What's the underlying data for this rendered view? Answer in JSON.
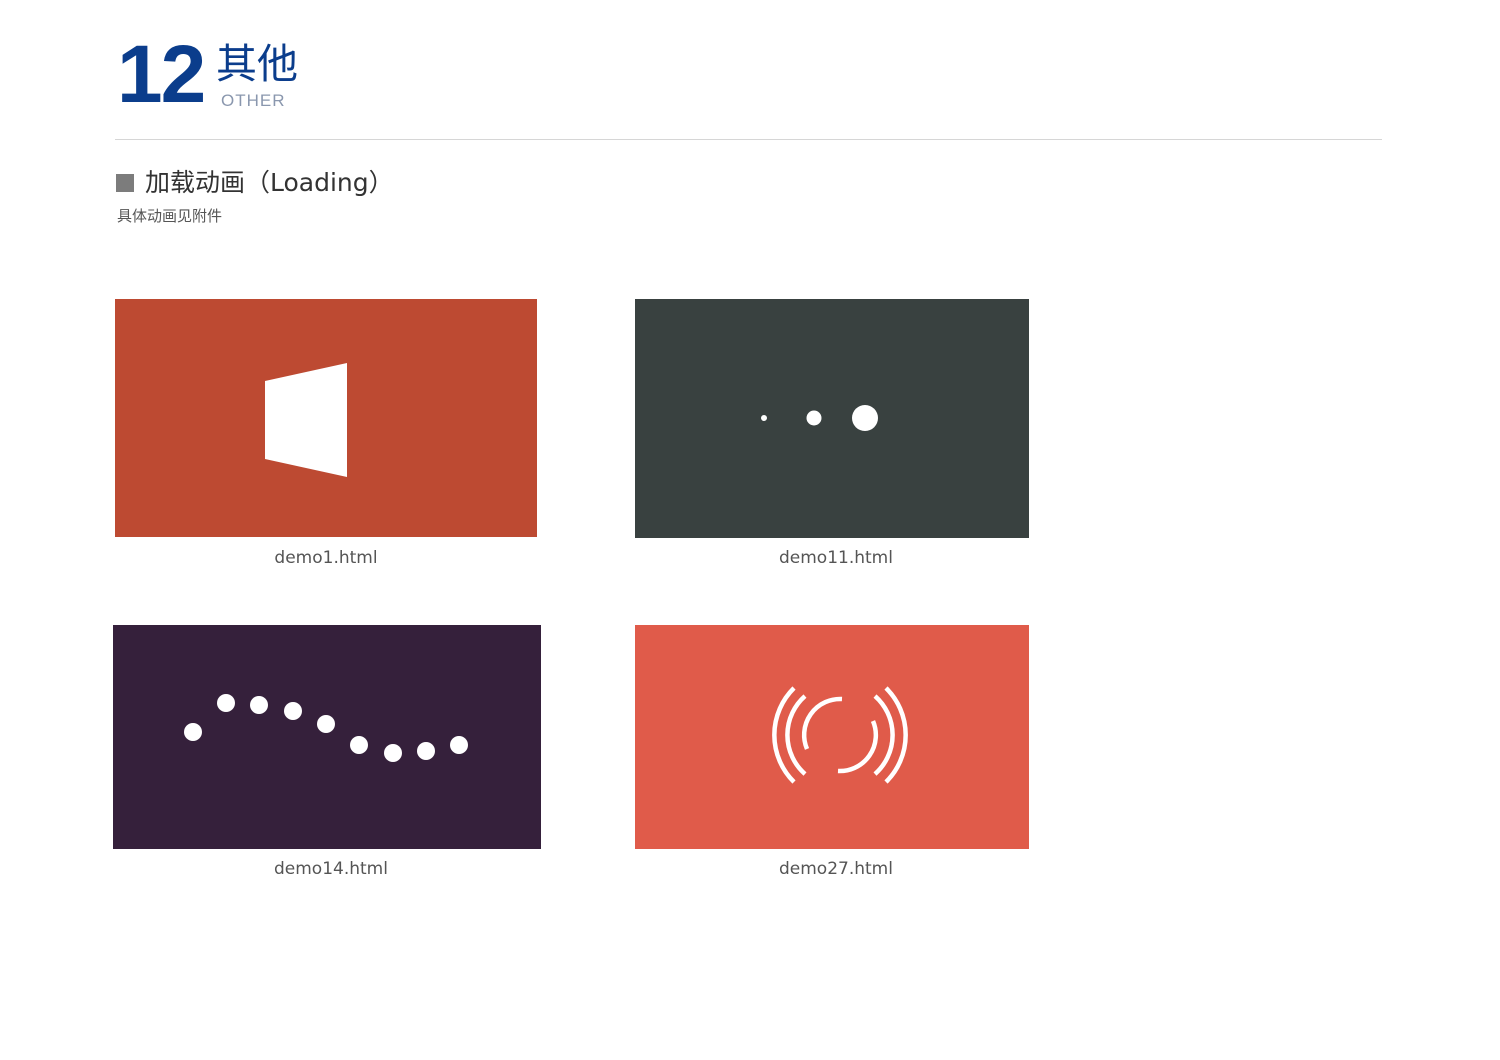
{
  "section": {
    "number": "12",
    "title_cn": "其他",
    "title_en": "OTHER"
  },
  "subsection": {
    "heading": "加载动画（Loading）",
    "note": "具体动画见附件"
  },
  "demos": [
    {
      "caption": "demo1.html",
      "background": "#bd4a32",
      "icon": "folding-panel-icon"
    },
    {
      "caption": "demo11.html",
      "background": "#394140",
      "icon": "growing-dots-icon"
    },
    {
      "caption": "demo14.html",
      "background": "#35203b",
      "icon": "wave-dots-icon"
    },
    {
      "caption": "demo27.html",
      "background": "#e05b4a",
      "icon": "arc-rings-icon"
    }
  ],
  "colors": {
    "brand_blue": "#0b3d8c",
    "muted_blue": "#8a97ae",
    "text": "#333333",
    "caption": "#555555"
  }
}
